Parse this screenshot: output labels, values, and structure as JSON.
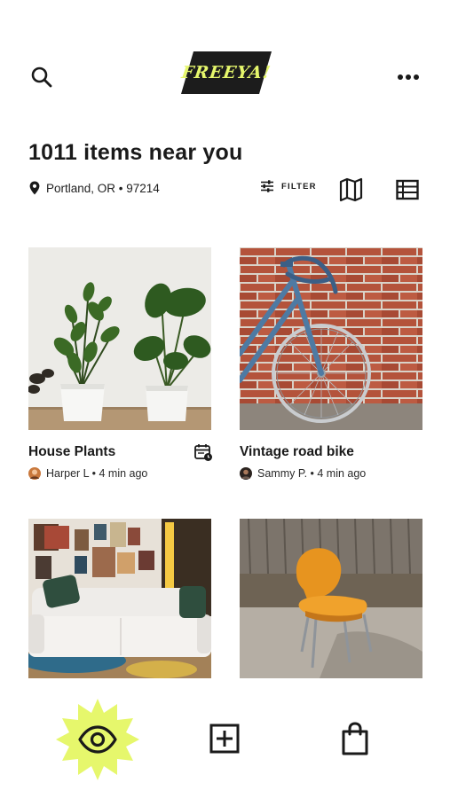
{
  "app": {
    "logo_text": "FREEYA!"
  },
  "header": {
    "title": "1011 items near you",
    "location": "Portland, OR • 97214"
  },
  "toolbar": {
    "filter_label": "FILTER"
  },
  "items": [
    {
      "title": "House Plants",
      "user": "Harper L",
      "time": "4 min ago",
      "meta": "Harper L • 4 min ago",
      "has_calendar": true
    },
    {
      "title": "Vintage road bike",
      "user": "Sammy P.",
      "time": "4 min ago",
      "meta": "Sammy P. • 4 min ago",
      "has_calendar": false
    },
    {
      "title": "",
      "meta": ""
    },
    {
      "title": "",
      "meta": ""
    }
  ],
  "nav": {
    "active": "browse",
    "items": [
      "browse-eye-icon",
      "add-icon",
      "bag-icon"
    ]
  },
  "colors": {
    "accent": "#e6f76c",
    "text": "#1a1a1a",
    "background": "#ffffff"
  }
}
